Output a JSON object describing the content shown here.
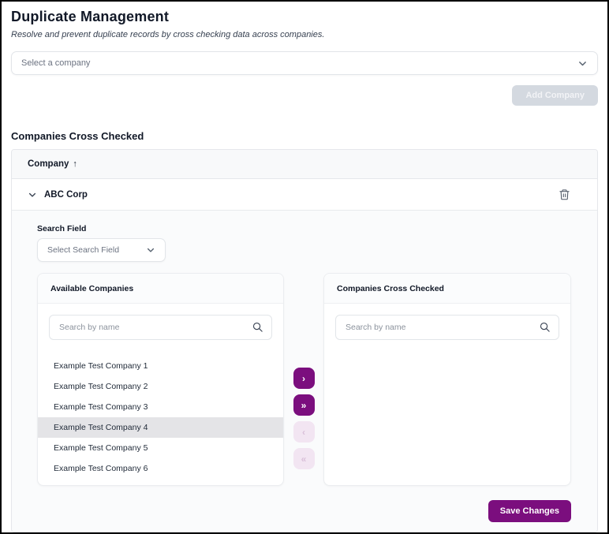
{
  "page": {
    "title": "Duplicate Management",
    "subtitle": "Resolve and prevent duplicate records by cross checking data across companies."
  },
  "company_select": {
    "placeholder": "Select a company"
  },
  "buttons": {
    "add_company": "Add Company",
    "save_changes": "Save Changes"
  },
  "section": {
    "heading": "Companies Cross Checked"
  },
  "table": {
    "column_header": "Company",
    "sort_arrow": "↑",
    "row": {
      "name": "ABC Corp"
    }
  },
  "detail": {
    "search_field_label": "Search Field",
    "search_field_placeholder": "Select Search Field",
    "available_panel": {
      "title": "Available Companies",
      "search_placeholder": "Search by name",
      "items": [
        "Example Test Company 1",
        "Example Test Company 2",
        "Example Test Company 3",
        "Example Test Company 4",
        "Example Test Company 5",
        "Example Test Company 6"
      ],
      "selected_index": 3
    },
    "crosschecked_panel": {
      "title": "Companies Cross Checked",
      "search_placeholder": "Search by name",
      "items": []
    },
    "transfer": {
      "move_right": "›",
      "move_all_right": "»",
      "move_left": "‹",
      "move_all_left": "«"
    }
  },
  "colors": {
    "primary": "#7b0e7e",
    "disabled_transfer_bg": "#f2e5f2",
    "selected_row_bg": "#e4e4e7",
    "table_header_bg": "#f8f9fa",
    "disabled_button_bg": "#d4d9e0"
  }
}
